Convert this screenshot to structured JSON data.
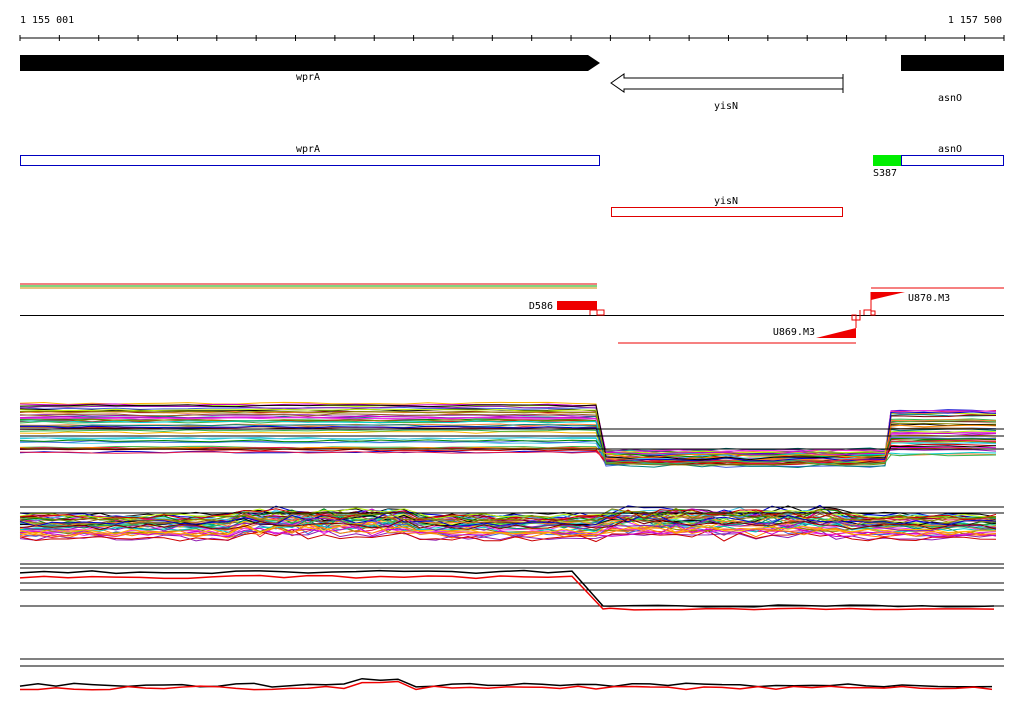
{
  "coords": {
    "start_label": "1 155 001",
    "end_label": "1 157 500"
  },
  "genes": {
    "wprA": "wprA",
    "yisN": "yisN",
    "asnO": "asnO"
  },
  "annotation_track": {
    "wprA": "wprA",
    "yisN": "yisN",
    "asnO": "asnO",
    "S387": "S387"
  },
  "features": {
    "D586": "D586",
    "U869": "U869.M3",
    "U870": "U870.M3"
  },
  "colors": {
    "gene_fill": "#000000",
    "annotation_blue": "#0000c0",
    "annotation_red": "#e00000",
    "feature_red": "#ee0000",
    "feature_green": "#00ee00"
  }
}
